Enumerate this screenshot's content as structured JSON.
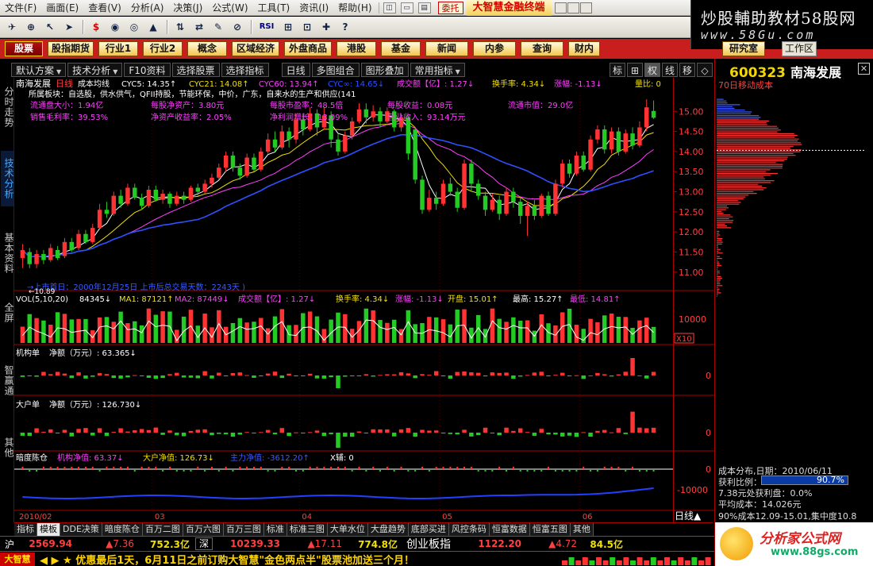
{
  "menu": {
    "items": [
      "文件(F)",
      "画面(E)",
      "查看(V)",
      "分析(A)",
      "决策(J)",
      "公式(W)",
      "工具(T)",
      "资讯(I)",
      "帮助(H)"
    ],
    "mdi_buttons": [
      "◫",
      "▭",
      "▤"
    ],
    "weituo": "委托",
    "brand": "大智慧金融终端"
  },
  "watermark_top": {
    "title": "炒股輔助教材58股网",
    "url": "www.58Gu.com"
  },
  "toolbar": {
    "icons": [
      "✈",
      "⊕",
      "↖",
      "➤",
      "$",
      "◉",
      "◎",
      "▲",
      "⇅",
      "⇄",
      "✎",
      "⊘",
      "RSI",
      "⊞",
      "⊡",
      "✚",
      "?"
    ]
  },
  "nav": {
    "buttons": [
      "股票",
      "股指期货",
      "行业1",
      "行业2",
      "概念",
      "区域经济",
      "外盘商品",
      "港股",
      "基金",
      "新闻",
      "内参",
      "查询",
      "财内"
    ],
    "research": "研究室",
    "work": "工作区"
  },
  "subtoolbar": {
    "items": [
      "默认方案",
      "技术分析",
      "F10资料",
      "选择股票",
      "选择指标",
      "日线",
      "多图组合",
      "图形叠加",
      "常用指标"
    ],
    "small": [
      "标",
      "⊞",
      "权",
      "线",
      "移",
      "◇"
    ]
  },
  "left_tabs": [
    "分时走势",
    "技术分析",
    "基本资料",
    "全屏",
    "智赢通",
    "其他"
  ],
  "chart": {
    "header": {
      "name": "南海发展",
      "period": "日线",
      "indicator": "成本均线",
      "cyc5": "CYC5: 14.35↑",
      "cyc21": "CYC21: 14.08↑",
      "cyc60": "CYC60: 13.94↑",
      "cyc_inf": "CYC∞: 14.65↓",
      "turnover_label": "成交额【亿】: 1.27↓",
      "rate": "换手率: 4.34↓",
      "change": "涨幅: -1.13↓",
      "ratio": "量比: 0"
    },
    "info": {
      "sector": "所属板块：自选股，供水供气，QFII持股，节能环保，中价，广东，自来水的生产和供应(141",
      "float_shares": "流通盘大小：1.94亿",
      "eps_nav": "每股净资产：3.80元",
      "pe": "每股市盈率：48.5倍",
      "eps": "每股收益：0.08元",
      "float_mv": "流通市值：29.0亿",
      "gross_margin": "销售毛利率：39.53%",
      "roe": "净资产收益率：2.05%",
      "profit_growth": "净利润增长：13.09%",
      "revenue": "营业收入：93.14万元"
    },
    "ipo_note": "→上市首日：2000年12月25日  上市后总交易天数：2243天  )",
    "low_marker": "←10.89",
    "vol_header": {
      "label": "VOL(5,10,20)",
      "v": "84345↓",
      "ma1": "MA1: 87121↑",
      "ma2": "MA2: 87449↓",
      "amt": "成交额【亿】: 1.27↓",
      "rate": "换手率: 4.34↓",
      "chg": "涨幅: -1.13↓",
      "open": "开盘: 15.01↑",
      "high": "最高: 15.27↑",
      "low": "最低: 14.81↑"
    },
    "inst_header": {
      "label": "机构单",
      "value": "净额（万元）: 63.365↓"
    },
    "big_header": {
      "label": "大户单",
      "value": "净额（万元）: 126.730↓"
    },
    "dark_header": {
      "label": "暗度陈仓",
      "inst": "机构净值: 63.37↓",
      "big": "大户净值: 126.73↓",
      "main": "主力净值: -3612.20↑",
      "x": "X辅: 0"
    },
    "x_labels": [
      "2010/02",
      "03",
      "04",
      "05",
      "06"
    ],
    "price_axis": [
      "15.00",
      "14.50",
      "14.00",
      "13.50",
      "13.00",
      "12.50",
      "12.00",
      "11.50",
      "11.00"
    ],
    "vol_axis": [
      "10000"
    ],
    "vol_unit": "X10",
    "zero_label": "0",
    "dark_axis": [
      "0",
      "-10000"
    ]
  },
  "chart_data": {
    "type": "candlestick",
    "title": "南海发展 日线",
    "x_labels": [
      "2010/02",
      "03",
      "04",
      "05",
      "06"
    ],
    "ylim": [
      10.7,
      15.4
    ],
    "candles": [
      {
        "o": 11.35,
        "c": 11.55,
        "h": 11.7,
        "l": 11.1
      },
      {
        "o": 11.5,
        "c": 11.2,
        "h": 11.6,
        "l": 11.1
      },
      {
        "o": 11.2,
        "c": 11.45,
        "h": 11.55,
        "l": 11.1
      },
      {
        "o": 11.45,
        "c": 11.3,
        "h": 11.55,
        "l": 11.2
      },
      {
        "o": 11.3,
        "c": 11.6,
        "h": 11.7,
        "l": 11.25
      },
      {
        "o": 11.55,
        "c": 11.35,
        "h": 11.65,
        "l": 11.3
      },
      {
        "o": 11.4,
        "c": 11.75,
        "h": 11.85,
        "l": 11.35
      },
      {
        "o": 11.75,
        "c": 11.55,
        "h": 11.85,
        "l": 11.5
      },
      {
        "o": 11.6,
        "c": 11.95,
        "h": 12.05,
        "l": 11.55
      },
      {
        "o": 11.95,
        "c": 11.75,
        "h": 12.05,
        "l": 11.7
      },
      {
        "o": 11.75,
        "c": 12.1,
        "h": 12.2,
        "l": 11.7
      },
      {
        "o": 12.1,
        "c": 12.55,
        "h": 12.7,
        "l": 12.05
      },
      {
        "o": 12.55,
        "c": 12.45,
        "h": 12.75,
        "l": 12.35
      },
      {
        "o": 12.45,
        "c": 12.9,
        "h": 13.0,
        "l": 12.4
      },
      {
        "o": 12.9,
        "c": 12.7,
        "h": 13.05,
        "l": 12.6
      },
      {
        "o": 12.7,
        "c": 13.1,
        "h": 13.2,
        "l": 12.65
      },
      {
        "o": 13.1,
        "c": 12.85,
        "h": 13.2,
        "l": 12.8
      },
      {
        "o": 12.85,
        "c": 12.65,
        "h": 12.95,
        "l": 12.55
      },
      {
        "o": 12.65,
        "c": 13.05,
        "h": 13.15,
        "l": 12.6
      },
      {
        "o": 13.05,
        "c": 12.8,
        "h": 13.15,
        "l": 12.75
      },
      {
        "o": 12.8,
        "c": 12.95,
        "h": 13.05,
        "l": 12.7
      },
      {
        "o": 12.95,
        "c": 12.7,
        "h": 13.0,
        "l": 12.6
      },
      {
        "o": 12.7,
        "c": 12.9,
        "h": 13.0,
        "l": 12.65
      },
      {
        "o": 12.9,
        "c": 12.8,
        "h": 13.0,
        "l": 12.7
      },
      {
        "o": 12.8,
        "c": 13.1,
        "h": 13.15,
        "l": 12.75
      },
      {
        "o": 13.1,
        "c": 13.0,
        "h": 13.2,
        "l": 12.9
      },
      {
        "o": 13.0,
        "c": 13.2,
        "h": 13.3,
        "l": 12.95
      },
      {
        "o": 13.2,
        "c": 13.35,
        "h": 13.45,
        "l": 13.1
      },
      {
        "o": 13.35,
        "c": 13.6,
        "h": 13.7,
        "l": 13.3
      },
      {
        "o": 13.6,
        "c": 13.9,
        "h": 14.0,
        "l": 13.5
      },
      {
        "o": 13.9,
        "c": 13.6,
        "h": 14.0,
        "l": 13.5
      },
      {
        "o": 13.6,
        "c": 13.4,
        "h": 13.7,
        "l": 13.3
      },
      {
        "o": 13.4,
        "c": 13.85,
        "h": 13.95,
        "l": 13.35
      },
      {
        "o": 13.85,
        "c": 13.55,
        "h": 13.95,
        "l": 13.5
      },
      {
        "o": 13.55,
        "c": 14.0,
        "h": 14.1,
        "l": 13.5
      },
      {
        "o": 14.0,
        "c": 14.3,
        "h": 14.45,
        "l": 13.95
      },
      {
        "o": 14.3,
        "c": 14.1,
        "h": 14.5,
        "l": 14.0
      },
      {
        "o": 14.1,
        "c": 14.5,
        "h": 14.65,
        "l": 14.05
      },
      {
        "o": 14.5,
        "c": 14.3,
        "h": 14.6,
        "l": 14.1
      },
      {
        "o": 14.3,
        "c": 14.8,
        "h": 14.95,
        "l": 14.2
      },
      {
        "o": 14.8,
        "c": 14.55,
        "h": 14.95,
        "l": 14.4
      },
      {
        "o": 14.55,
        "c": 14.95,
        "h": 15.1,
        "l": 14.5
      },
      {
        "o": 14.95,
        "c": 14.6,
        "h": 15.05,
        "l": 14.4
      },
      {
        "o": 14.6,
        "c": 14.9,
        "h": 15.1,
        "l": 14.55
      },
      {
        "o": 14.9,
        "c": 14.3,
        "h": 15.0,
        "l": 14.1
      },
      {
        "o": 14.3,
        "c": 14.0,
        "h": 14.45,
        "l": 13.9
      },
      {
        "o": 14.0,
        "c": 14.4,
        "h": 14.5,
        "l": 13.95
      },
      {
        "o": 14.4,
        "c": 14.75,
        "h": 14.85,
        "l": 14.3
      },
      {
        "o": 14.75,
        "c": 15.05,
        "h": 15.2,
        "l": 14.7
      },
      {
        "o": 15.05,
        "c": 14.85,
        "h": 15.2,
        "l": 14.7
      },
      {
        "o": 14.85,
        "c": 15.0,
        "h": 15.15,
        "l": 14.75
      },
      {
        "o": 15.0,
        "c": 14.75,
        "h": 15.1,
        "l": 14.6
      },
      {
        "o": 14.75,
        "c": 15.0,
        "h": 15.1,
        "l": 14.7
      },
      {
        "o": 15.0,
        "c": 14.6,
        "h": 15.05,
        "l": 14.5
      },
      {
        "o": 14.6,
        "c": 14.85,
        "h": 14.95,
        "l": 14.5
      },
      {
        "o": 14.85,
        "c": 13.95,
        "h": 14.9,
        "l": 13.8
      },
      {
        "o": 14.55,
        "c": 13.3,
        "h": 14.6,
        "l": 13.2
      },
      {
        "o": 13.3,
        "c": 12.55,
        "h": 13.4,
        "l": 12.45
      },
      {
        "o": 12.55,
        "c": 12.85,
        "h": 13.05,
        "l": 12.5
      },
      {
        "o": 12.85,
        "c": 12.7,
        "h": 13.0,
        "l": 12.55
      },
      {
        "o": 12.7,
        "c": 13.2,
        "h": 13.3,
        "l": 12.65
      },
      {
        "o": 13.2,
        "c": 13.0,
        "h": 13.35,
        "l": 12.9
      },
      {
        "o": 13.0,
        "c": 12.6,
        "h": 13.1,
        "l": 12.5
      },
      {
        "o": 12.6,
        "c": 13.7,
        "h": 13.8,
        "l": 12.55
      },
      {
        "o": 13.7,
        "c": 13.2,
        "h": 13.8,
        "l": 13.0
      },
      {
        "o": 13.2,
        "c": 12.9,
        "h": 13.3,
        "l": 12.8
      },
      {
        "o": 12.9,
        "c": 12.55,
        "h": 13.0,
        "l": 12.4
      },
      {
        "o": 12.55,
        "c": 12.8,
        "h": 12.95,
        "l": 12.5
      },
      {
        "o": 12.8,
        "c": 12.45,
        "h": 12.9,
        "l": 12.3
      },
      {
        "o": 12.45,
        "c": 13.0,
        "h": 13.1,
        "l": 12.4
      },
      {
        "o": 13.0,
        "c": 12.75,
        "h": 13.1,
        "l": 12.6
      },
      {
        "o": 12.75,
        "c": 12.4,
        "h": 12.85,
        "l": 12.2
      },
      {
        "o": 12.4,
        "c": 12.65,
        "h": 12.75,
        "l": 11.9
      },
      {
        "o": 12.65,
        "c": 12.4,
        "h": 12.8,
        "l": 12.3
      },
      {
        "o": 12.4,
        "c": 12.9,
        "h": 12.95,
        "l": 12.35
      },
      {
        "o": 12.9,
        "c": 12.45,
        "h": 13.0,
        "l": 12.4
      },
      {
        "o": 12.45,
        "c": 13.2,
        "h": 13.3,
        "l": 12.4
      },
      {
        "o": 13.2,
        "c": 13.7,
        "h": 13.8,
        "l": 13.1
      },
      {
        "o": 13.7,
        "c": 13.45,
        "h": 13.8,
        "l": 13.35
      },
      {
        "o": 13.45,
        "c": 13.9,
        "h": 14.0,
        "l": 13.4
      },
      {
        "o": 13.9,
        "c": 13.55,
        "h": 14.0,
        "l": 13.5
      },
      {
        "o": 13.55,
        "c": 14.3,
        "h": 14.4,
        "l": 13.5
      },
      {
        "o": 14.3,
        "c": 14.55,
        "h": 14.65,
        "l": 14.2
      },
      {
        "o": 14.55,
        "c": 14.05,
        "h": 14.65,
        "l": 13.95
      },
      {
        "o": 14.05,
        "c": 14.5,
        "h": 14.6,
        "l": 13.95
      },
      {
        "o": 14.5,
        "c": 14.0,
        "h": 14.6,
        "l": 13.9
      },
      {
        "o": 14.0,
        "c": 14.45,
        "h": 14.55,
        "l": 13.95
      },
      {
        "o": 14.45,
        "c": 14.15,
        "h": 14.6,
        "l": 14.05
      },
      {
        "o": 14.15,
        "c": 14.6,
        "h": 14.75,
        "l": 14.1
      },
      {
        "o": 14.6,
        "c": 15.1,
        "h": 15.3,
        "l": 14.5
      },
      {
        "o": 15.01,
        "c": 14.84,
        "h": 15.27,
        "l": 14.81
      }
    ],
    "series": [
      {
        "name": "CYC5",
        "color": "#ffffff"
      },
      {
        "name": "CYC21",
        "color": "#f2e000"
      },
      {
        "name": "CYC60",
        "color": "#ff40ff"
      },
      {
        "name": "CYC∞",
        "color": "#3050ff"
      }
    ],
    "volume": {
      "label": "VOL(5,10,20)",
      "ylim": [
        0,
        15000
      ]
    },
    "inst_net": {
      "label": "机构单",
      "last": 63.365
    },
    "big_net": {
      "label": "大户单",
      "last": 126.73
    },
    "dark": {
      "label": "暗度陈仓",
      "ylim": [
        -15000,
        2000
      ]
    }
  },
  "cost_panel": {
    "code": "600323",
    "name": "南海发展",
    "label": "70日移动成本",
    "dist_title": "成本分布,日期：2010/06/11",
    "profit_label": "获利比例：",
    "profit_value": "90.7%",
    "line2": "7.38元处获利盘：0.0%",
    "avg": "平均成本：14.026元",
    "cost90": "90%成本12.09-15.01,集中度10.8"
  },
  "bottom_tabs": [
    "指标",
    "模板",
    "DDE决策",
    "暗度陈仓",
    "百万二图",
    "百万六图",
    "百万三图",
    "标准",
    "标准三图",
    "大单水位",
    "大盘趋势",
    "底部买进",
    "风控条码",
    "恒富数据",
    "恒富五图",
    "其他"
  ],
  "bottom_active": 1,
  "period_tag": "日线▲",
  "indexbar": {
    "sh_name": "沪",
    "sh_val": "2569.94",
    "sh_chg": "▲7.36",
    "sh_amt": "752.3亿",
    "sz_name": "深",
    "sz_val": "10239.33",
    "sz_chg": "▲17.11",
    "sz_amt": "774.8亿",
    "cy_name": "创业板指",
    "cy_val": "1122.20",
    "cy_chg": "▲4.72",
    "cy_amt": "84.5亿"
  },
  "ticker": {
    "logo": "大智慧",
    "text": "◀ ▶ ★ 优惠最后1天，6月11日之前订购大智慧\"金色两点半\"股票池加送三个月！"
  },
  "watermark_bottom": {
    "title": "分析家公式网",
    "url": "www.88gs.com"
  },
  "colors": {
    "up": "#ff3333",
    "down": "#22cc22",
    "bg": "#000000",
    "axis": "#aa0000"
  }
}
